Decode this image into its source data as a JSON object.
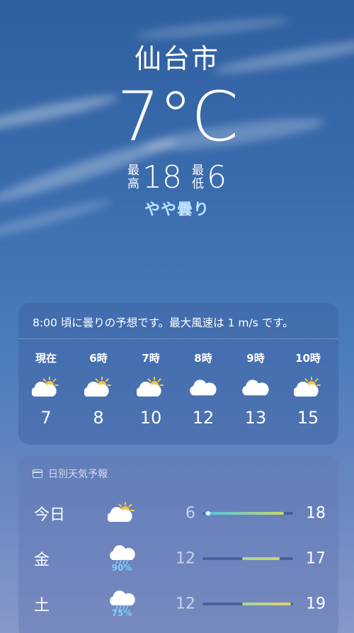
{
  "location": {
    "city": "仙台市",
    "temperature": "7°C",
    "high_label_1": "最",
    "high_label_2": "高",
    "high": "18",
    "low_label_1": "最",
    "low_label_2": "低",
    "low": "6",
    "condition": "やや曇り"
  },
  "hourly": {
    "summary": "8:00 頃に曇りの予想です。最大風速は 1 m/s です。",
    "items": [
      {
        "time": "現在",
        "icon": "partly-cloudy-icon",
        "temp": "7"
      },
      {
        "time": "6時",
        "icon": "partly-cloudy-icon",
        "temp": "8"
      },
      {
        "time": "7時",
        "icon": "partly-cloudy-icon",
        "temp": "10"
      },
      {
        "time": "8時",
        "icon": "cloud-icon",
        "temp": "12"
      },
      {
        "time": "9時",
        "icon": "cloud-icon",
        "temp": "13"
      },
      {
        "time": "10時",
        "icon": "partly-cloudy-icon",
        "temp": "15"
      }
    ]
  },
  "daily": {
    "title": "日別天気予報",
    "days": [
      {
        "name": "今日",
        "icon": "partly-cloudy-icon",
        "pop": "",
        "low": "6",
        "high": "18",
        "range_start": 0.02,
        "range_end": 0.9
      },
      {
        "name": "金",
        "icon": "rain-icon",
        "pop": "90%",
        "low": "12",
        "high": "17",
        "range_start": 0.44,
        "range_end": 0.85
      },
      {
        "name": "土",
        "icon": "rain-icon",
        "pop": "75%",
        "low": "12",
        "high": "19",
        "range_start": 0.44,
        "range_end": 0.98
      }
    ]
  },
  "colors": {
    "condition": "#bfe3ff",
    "precip": "#7fd0ff",
    "bar_cool": "#4fc3e6",
    "bar_warm": "#c8d86a"
  }
}
